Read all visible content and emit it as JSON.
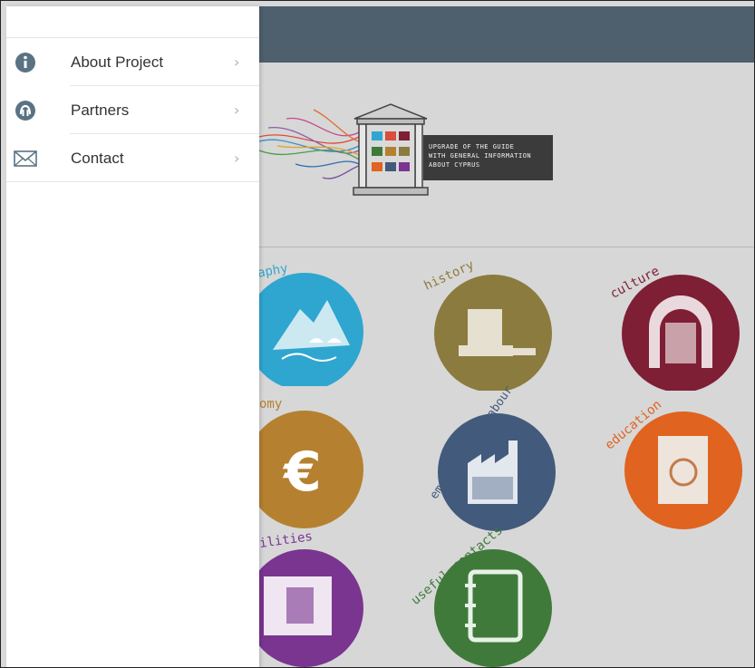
{
  "drawer": {
    "items": [
      {
        "label": "About Project",
        "icon": "info-icon"
      },
      {
        "label": "Partners",
        "icon": "handshake-icon"
      },
      {
        "label": "Contact",
        "icon": "envelope-icon"
      }
    ],
    "chevron": "›"
  },
  "header": {
    "tagline_lines": [
      "UPGRADE OF THE GUIDE",
      "WITH GENERAL INFORMATION",
      "ABOUT CYPRUS"
    ]
  },
  "categories": [
    {
      "label": "aphy",
      "color": "#2fa6cf"
    },
    {
      "label": "history",
      "color": "#8c7b3f"
    },
    {
      "label": "culture",
      "color": "#7e1f35"
    },
    {
      "label": "omy",
      "color": "#b58130"
    },
    {
      "label": "employment & labour",
      "color": "#425a7c"
    },
    {
      "label": "education",
      "color": "#e0631f"
    },
    {
      "label": "ilities",
      "color": "#7a3590"
    },
    {
      "label": "useful contacts",
      "color": "#3f7a3a"
    }
  ],
  "colors": {
    "topbar": "#4e5f6e",
    "drawer_bg": "#ffffff",
    "icon_color": "#5a7383"
  }
}
